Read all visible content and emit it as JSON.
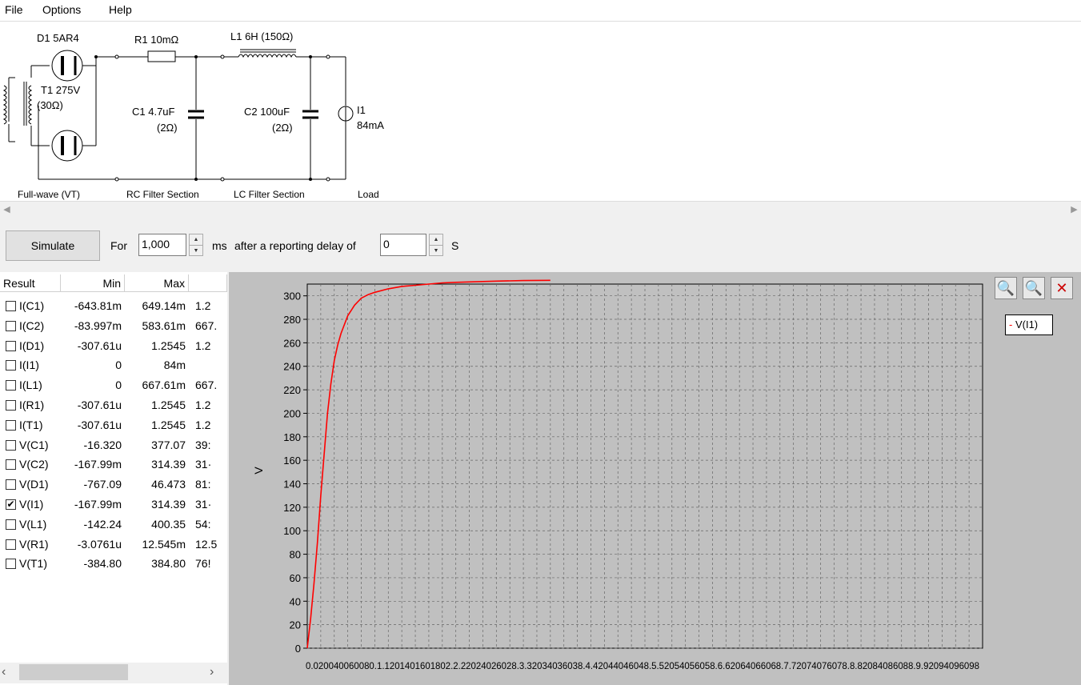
{
  "menu": {
    "file": "File",
    "options": "Options",
    "help": "Help"
  },
  "schematic": {
    "d1_label": "D1 5AR4",
    "r1_label": "R1 10mΩ",
    "l1_label": "L1 6H (150Ω)",
    "t1_label": "T1 275V",
    "t1_res": "(30Ω)",
    "c1_label": "C1 4.7uF",
    "c1_res": "(2Ω)",
    "c2_label": "C2 100uF",
    "c2_res": "(2Ω)",
    "i1_label": "I1",
    "i1_value": "84mA",
    "section_fullwave": "Full-wave (VT)",
    "section_rc": "RC Filter Section",
    "section_lc": "LC Filter Section",
    "section_load": "Load"
  },
  "controls": {
    "simulate": "Simulate",
    "for_label": "For",
    "duration": "1,000",
    "ms_label": "ms",
    "delay_label": "after a reporting delay of",
    "delay": "0",
    "s_label": "S"
  },
  "table": {
    "headers": [
      "Result",
      "Min",
      "Max"
    ],
    "rows": [
      {
        "name": "I(C1)",
        "min": "-643.81m",
        "max": "649.14m",
        "extra": "1.2",
        "checked": false
      },
      {
        "name": "I(C2)",
        "min": "-83.997m",
        "max": "583.61m",
        "extra": "667.",
        "checked": false
      },
      {
        "name": "I(D1)",
        "min": "-307.61u",
        "max": "1.2545",
        "extra": "1.2",
        "checked": false
      },
      {
        "name": "I(I1)",
        "min": "0",
        "max": "84m",
        "extra": "",
        "checked": false
      },
      {
        "name": "I(L1)",
        "min": "0",
        "max": "667.61m",
        "extra": "667.",
        "checked": false
      },
      {
        "name": "I(R1)",
        "min": "-307.61u",
        "max": "1.2545",
        "extra": "1.2",
        "checked": false
      },
      {
        "name": "I(T1)",
        "min": "-307.61u",
        "max": "1.2545",
        "extra": "1.2",
        "checked": false
      },
      {
        "name": "V(C1)",
        "min": "-16.320",
        "max": "377.07",
        "extra": "39:",
        "checked": false
      },
      {
        "name": "V(C2)",
        "min": "-167.99m",
        "max": "314.39",
        "extra": "31·",
        "checked": false
      },
      {
        "name": "V(D1)",
        "min": "-767.09",
        "max": "46.473",
        "extra": "81:",
        "checked": false
      },
      {
        "name": "V(I1)",
        "min": "-167.99m",
        "max": "314.39",
        "extra": "31·",
        "checked": true
      },
      {
        "name": "V(L1)",
        "min": "-142.24",
        "max": "400.35",
        "extra": "54:",
        "checked": false
      },
      {
        "name": "V(R1)",
        "min": "-3.0761u",
        "max": "12.545m",
        "extra": "12.5",
        "checked": false
      },
      {
        "name": "V(T1)",
        "min": "-384.80",
        "max": "384.80",
        "extra": "76!",
        "checked": false
      }
    ]
  },
  "legend": {
    "series": "V(I1)",
    "color": "#ff0000"
  },
  "chart_data": {
    "type": "line",
    "ylabel": "V",
    "ylim": [
      0,
      310
    ],
    "yticks": [
      0,
      20,
      40,
      60,
      80,
      100,
      120,
      140,
      160,
      180,
      200,
      220,
      240,
      260,
      280,
      300
    ],
    "xlim": [
      0,
      1.0
    ],
    "xtick_text": "0.020040060080.1.1201401601802.2.22024026028.3.32034036038.4.42044046048.5.52054056058.6.62064066068.7.72074076078.8.82084086088.9.92094096098",
    "series": [
      {
        "name": "V(I1)",
        "color": "#ff0000",
        "x": [
          0,
          0.005,
          0.01,
          0.015,
          0.02,
          0.025,
          0.03,
          0.035,
          0.04,
          0.045,
          0.05,
          0.06,
          0.07,
          0.08,
          0.09,
          0.1,
          0.12,
          0.14,
          0.16,
          0.18,
          0.2,
          0.22,
          0.25,
          0.28,
          0.32,
          0.36
        ],
        "y": [
          0,
          25,
          55,
          90,
          130,
          165,
          200,
          225,
          245,
          258,
          268,
          283,
          292,
          298,
          301,
          303,
          306,
          308,
          309,
          310,
          311,
          311.5,
          312,
          312.5,
          313,
          313.2
        ]
      }
    ]
  }
}
